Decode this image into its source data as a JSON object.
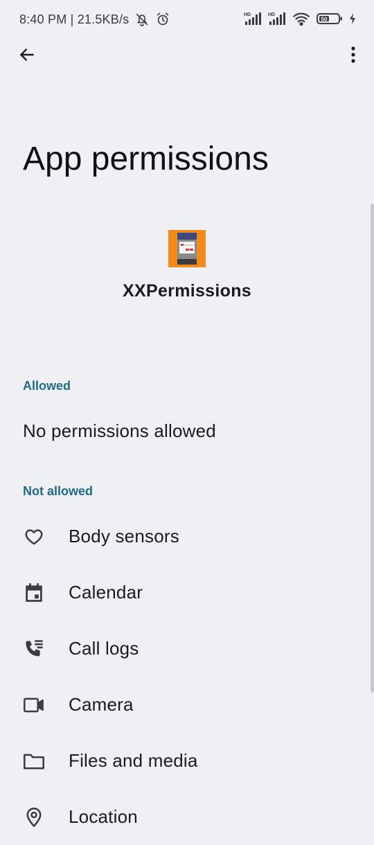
{
  "status_bar": {
    "time_speed": "8:40 PM | 21.5KB/s",
    "left_icons": [
      "mute-icon",
      "alarm-icon"
    ],
    "right_icons": [
      "signal-hd-icon",
      "signal-hd-icon",
      "wifi-icon",
      "battery-icon",
      "charging-icon"
    ],
    "signal_1_label": "HD",
    "signal_2_label": "HD",
    "battery_level": "50"
  },
  "top_bar": {
    "back_icon": "arrow-back-icon",
    "more_icon": "more-vert-icon"
  },
  "page": {
    "title": "App permissions"
  },
  "app": {
    "name": "XXPermissions",
    "icon_color": "#f28b1c"
  },
  "sections": {
    "allowed_header": "Allowed",
    "allowed_empty": "No permissions allowed",
    "not_allowed_header": "Not allowed"
  },
  "not_allowed_items": [
    {
      "label": "Body sensors",
      "icon": "heart-icon"
    },
    {
      "label": "Calendar",
      "icon": "calendar-icon"
    },
    {
      "label": "Call logs",
      "icon": "call-log-icon"
    },
    {
      "label": "Camera",
      "icon": "videocam-icon"
    },
    {
      "label": "Files and media",
      "icon": "folder-icon"
    },
    {
      "label": "Location",
      "icon": "location-icon"
    }
  ],
  "colors": {
    "background": "#eff0f3",
    "section_header": "#1f6a84",
    "text_primary": "#1b1b1f"
  }
}
